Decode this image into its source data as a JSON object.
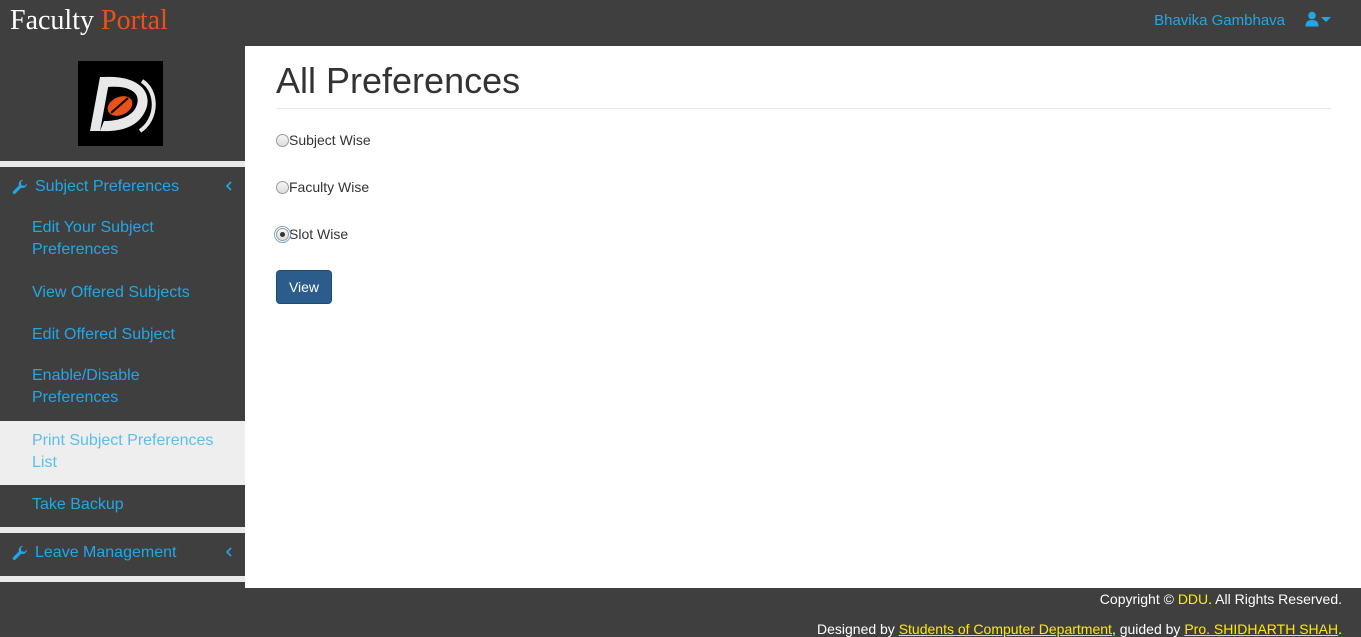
{
  "navbar": {
    "brand_word1": "Faculty",
    "brand_word2": "Portal",
    "user_name": "Bhavika Gambhava",
    "user_icon": "user-icon",
    "caret_icon": "caret-down-icon"
  },
  "sidebar": {
    "logo_alt": "DDU",
    "sections": [
      {
        "label": "Subject Preferences",
        "icon": "wrench-icon",
        "chevron": "chevron-left-icon"
      },
      {
        "label": "Leave Management",
        "icon": "wrench-icon",
        "chevron": "chevron-left-icon"
      }
    ],
    "items": [
      {
        "label": "Edit Your Subject Preferences"
      },
      {
        "label": "View Offered Subjects"
      },
      {
        "label": "Edit Offered Subject"
      },
      {
        "label": "Enable/Disable Preferences"
      },
      {
        "label": "Print Subject Preferences List",
        "active": true
      },
      {
        "label": "Take Backup"
      }
    ]
  },
  "main": {
    "title": "All Preferences",
    "options": [
      {
        "label": "Subject Wise",
        "checked": false
      },
      {
        "label": "Faculty Wise",
        "checked": false
      },
      {
        "label": "Slot Wise",
        "checked": true
      }
    ],
    "view_button": "View"
  },
  "footer": {
    "copy_prefix": "Copyright © ",
    "copy_link": "DDU",
    "copy_suffix": ". All Rights Reserved.",
    "designed_prefix": "Designed by ",
    "designed_link1": "Students of Computer Department",
    "designed_mid": ", guided by ",
    "designed_link2": "Pro. SHIDHARTH SHAH",
    "designed_suffix": "."
  },
  "colors": {
    "accent": "#22a7e6",
    "brand_orange": "#e8521a",
    "button": "#2b5c8b",
    "footer_link": "#ffeb00",
    "dark_bg": "#3f3f3f"
  }
}
